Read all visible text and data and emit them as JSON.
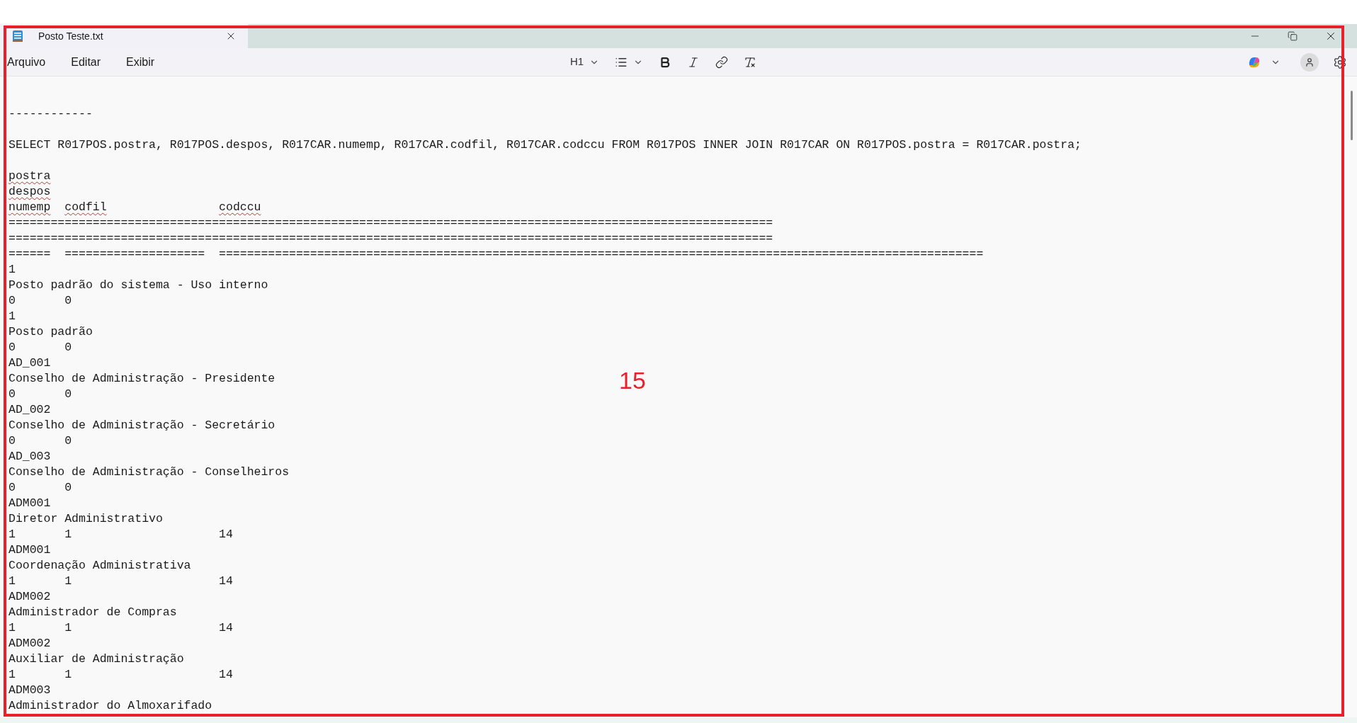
{
  "window": {
    "tab": {
      "title": "Posto Teste.txt",
      "selected": true
    }
  },
  "menu": [
    "Arquivo",
    "Editar",
    "Exibir"
  ],
  "toolbar": {
    "heading_label": "H1"
  },
  "lines": [
    {
      "text": "------------"
    },
    {
      "text": "SELECT R017POS.postra, R017POS.despos, R017CAR.numemp, R017CAR.codfil, R017CAR.codccu FROM R017POS INNER JOIN R017CAR ON R017POS.postra = R017CAR.postra;",
      "blank_before": true
    },
    {
      "text": "postra",
      "blank_before": true,
      "flagged": true
    },
    {
      "text": "despos",
      "flagged": true
    },
    {
      "text": "numemp  codfil                codccu",
      "flagged": true
    },
    {
      "text": "============================================================================================================="
    },
    {
      "text": "============================================================================================================="
    },
    {
      "text": "======  ====================  ============================================================================================================="
    },
    {
      "text": "1"
    },
    {
      "text": "Posto padrão do sistema - Uso interno"
    },
    {
      "text": "0       0"
    },
    {
      "text": "1"
    },
    {
      "text": "Posto padrão"
    },
    {
      "text": "0       0"
    },
    {
      "text": "AD_001"
    },
    {
      "text": "Conselho de Administração - Presidente"
    },
    {
      "text": "0       0"
    },
    {
      "text": "AD_002"
    },
    {
      "text": "Conselho de Administração - Secretário"
    },
    {
      "text": "0       0"
    },
    {
      "text": "AD_003"
    },
    {
      "text": "Conselho de Administração - Conselheiros"
    },
    {
      "text": "0       0"
    },
    {
      "text": "ADM001"
    },
    {
      "text": "Diretor Administrativo"
    },
    {
      "text": "1       1                     14"
    },
    {
      "text": "ADM001"
    },
    {
      "text": "Coordenação Administrativa"
    },
    {
      "text": "1       1                     14"
    },
    {
      "text": "ADM002"
    },
    {
      "text": "Administrador de Compras"
    },
    {
      "text": "1       1                     14"
    },
    {
      "text": "ADM002"
    },
    {
      "text": "Auxiliar de Administração"
    },
    {
      "text": "1       1                     14"
    },
    {
      "text": "ADM003"
    },
    {
      "text": "Administrador do Almoxarifado"
    }
  ],
  "annotation": {
    "label": "15"
  }
}
